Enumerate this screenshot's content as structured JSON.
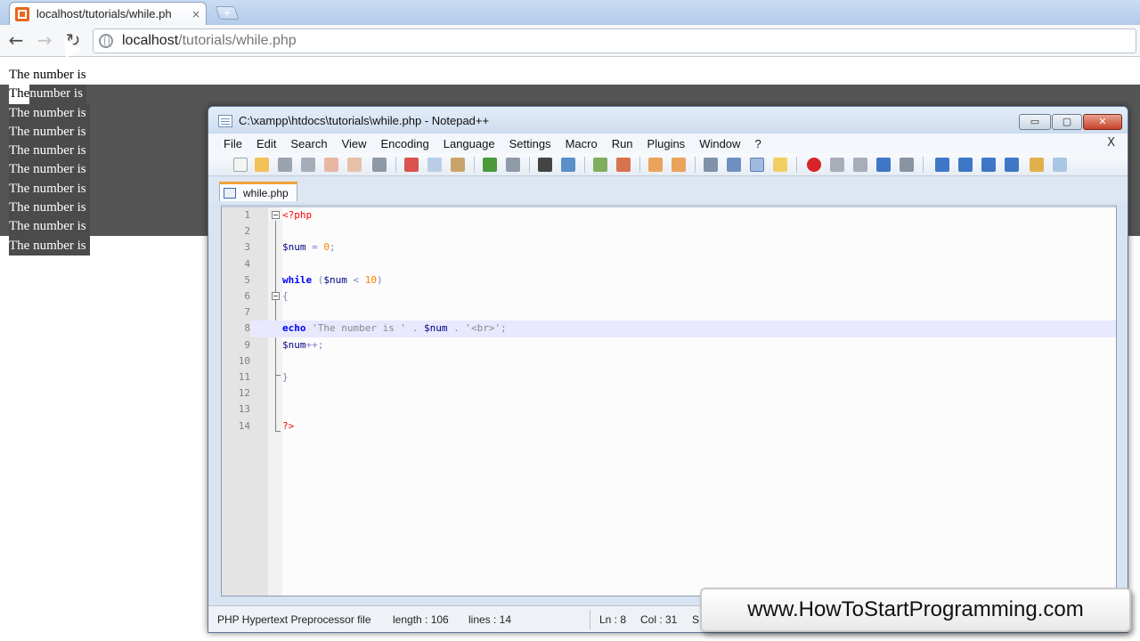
{
  "browser": {
    "tab_title": "localhost/tutorials/while.ph",
    "tab_close": "×",
    "new_tab": "+",
    "url_host": "localhost",
    "url_path": "/tutorials/while.php",
    "back_icon": "←",
    "forward_icon": "→",
    "reload_icon": "↻"
  },
  "page": {
    "lines": [
      "The number is",
      "The number is",
      "The number is",
      "The number is",
      "The number is",
      "The number is",
      "The number is",
      "The number is",
      "The number is",
      "The number is"
    ],
    "partial_prefix": "The",
    "partial_suffix": " number is"
  },
  "npp": {
    "title": "C:\\xampp\\htdocs\\tutorials\\while.php - Notepad++",
    "min": "▭",
    "max": "▢",
    "close": "✕",
    "menu": [
      "File",
      "Edit",
      "Search",
      "View",
      "Encoding",
      "Language",
      "Settings",
      "Macro",
      "Run",
      "Plugins",
      "Window",
      "?"
    ],
    "menu_close": "X",
    "file_tab": "while.php",
    "line_numbers": [
      "1",
      "2",
      "3",
      "4",
      "5",
      "6",
      "7",
      "8",
      "9",
      "10",
      "11",
      "12",
      "13",
      "14"
    ],
    "code": {
      "l1": "<?php",
      "l3_var": "$num",
      "l3_op": " = ",
      "l3_num": "0",
      "l3_end": ";",
      "l5_kw": "while",
      "l5_open": " (",
      "l5_var": "$num",
      "l5_op": " < ",
      "l5_num": "10",
      "l5_close": ")",
      "l6": "{",
      "l8_kw": "echo",
      "l8_str1": " 'The number is '",
      "l8_dot1": " . ",
      "l8_var": "$num",
      "l8_dot2": " . ",
      "l8_str2": "'<br>'",
      "l8_end": ";",
      "l9_var": "$num",
      "l9_op": "++;",
      "l11": "}",
      "l14": "?>"
    },
    "status": {
      "lang": "PHP Hypertext Preprocessor file",
      "length": "length : 106",
      "lines": "lines : 14",
      "ln": "Ln : 8",
      "col": "Col : 31",
      "sel": "S"
    }
  },
  "watermark": "www.HowToStartProgramming.com",
  "colors": {
    "php_tag": "#ff0000",
    "variable": "#000080",
    "number": "#ff8000",
    "keyword": "#0000ff",
    "string": "#8a8a8a",
    "current_line": "#e8e8ff"
  }
}
